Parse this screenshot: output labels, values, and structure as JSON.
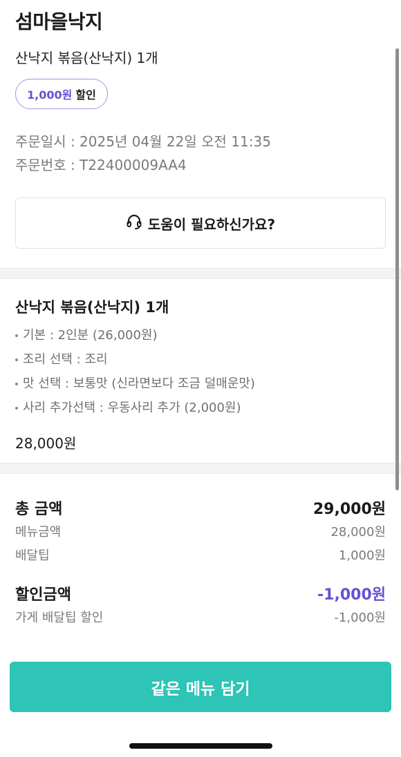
{
  "header": {
    "store_name": "섬마을낙지",
    "order_summary": "산낙지 볶음(산낙지) 1개",
    "discount_badge": {
      "amount": "1,000원",
      "label": "할인"
    },
    "order_date": "주문일시 : 2025년 04월 22일 오전 11:35",
    "order_number": "주문번호 : T22400009AA4",
    "help_button": "도움이 필요하신가요?"
  },
  "item": {
    "title": "산낙지 볶음(산낙지) 1개",
    "options": [
      "기본 : 2인분 (26,000원)",
      "조리 선택 : 조리",
      "맛 선택 : 보통맛 (신라면보다 조금 덜매운맛)",
      "사리 추가선택 : 우동사리 추가 (2,000원)"
    ],
    "price": "28,000원"
  },
  "totals": {
    "total_label": "총 금액",
    "total_value": "29,000원",
    "menu_label": "메뉴금액",
    "menu_value": "28,000원",
    "delivery_label": "배달팁",
    "delivery_value": "1,000원",
    "discount_label": "할인금액",
    "discount_value": "-1,000원",
    "store_discount_label": "가게 배달팁 할인",
    "store_discount_value": "-1,000원"
  },
  "cta": {
    "label": "같은 메뉴 담기"
  },
  "colors": {
    "accent_purple": "#6a4fd1",
    "cta_teal": "#2ec4b6"
  },
  "icons": {
    "help": "headset-icon"
  }
}
